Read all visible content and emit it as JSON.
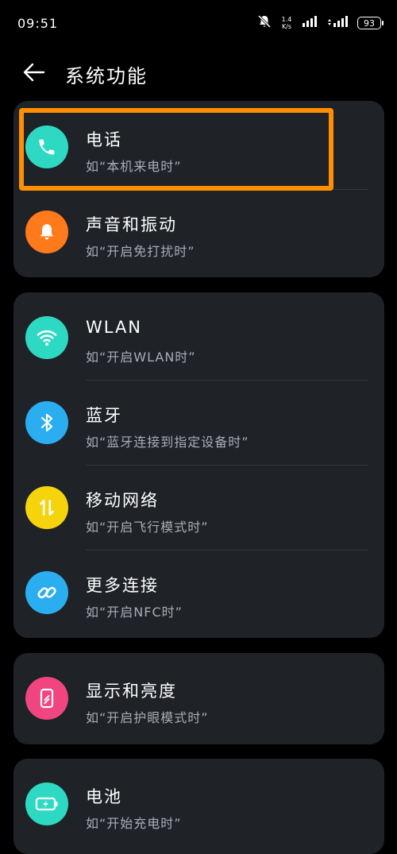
{
  "status_bar": {
    "time": "09:51",
    "speed_value": "1.4",
    "speed_unit": "K/s",
    "battery": "93"
  },
  "header": {
    "title": "系统功能",
    "back_icon": "arrow-left-icon"
  },
  "groups": [
    {
      "items": [
        {
          "title": "电话",
          "subtitle": "如“本机来电时”",
          "icon": "phone-icon",
          "color": "#2ed9c3"
        },
        {
          "title": "声音和振动",
          "subtitle": "如“开启免打扰时”",
          "icon": "bell-icon",
          "color": "#ff7a1a"
        }
      ]
    },
    {
      "items": [
        {
          "title": "WLAN",
          "subtitle": "如“开启WLAN时”",
          "icon": "wifi-icon",
          "color": "#2ed9c3"
        },
        {
          "title": "蓝牙",
          "subtitle": "如“蓝牙连接到指定设备时”",
          "icon": "bluetooth-icon",
          "color": "#2aaef0"
        },
        {
          "title": "移动网络",
          "subtitle": "如“开启飞行模式时”",
          "icon": "mobile-data-icon",
          "color": "#f6d40c"
        },
        {
          "title": "更多连接",
          "subtitle": "如“开启NFC时”",
          "icon": "link-icon",
          "color": "#2aaef0"
        }
      ]
    },
    {
      "items": [
        {
          "title": "显示和亮度",
          "subtitle": "如“开启护眼模式时”",
          "icon": "display-icon",
          "color": "#f0457e"
        }
      ]
    },
    {
      "items": [
        {
          "title": "电池",
          "subtitle": "如“开始充电时”",
          "icon": "battery-charging-icon",
          "color": "#2ed9c3"
        }
      ]
    }
  ],
  "highlight_color": "#ff8f00"
}
